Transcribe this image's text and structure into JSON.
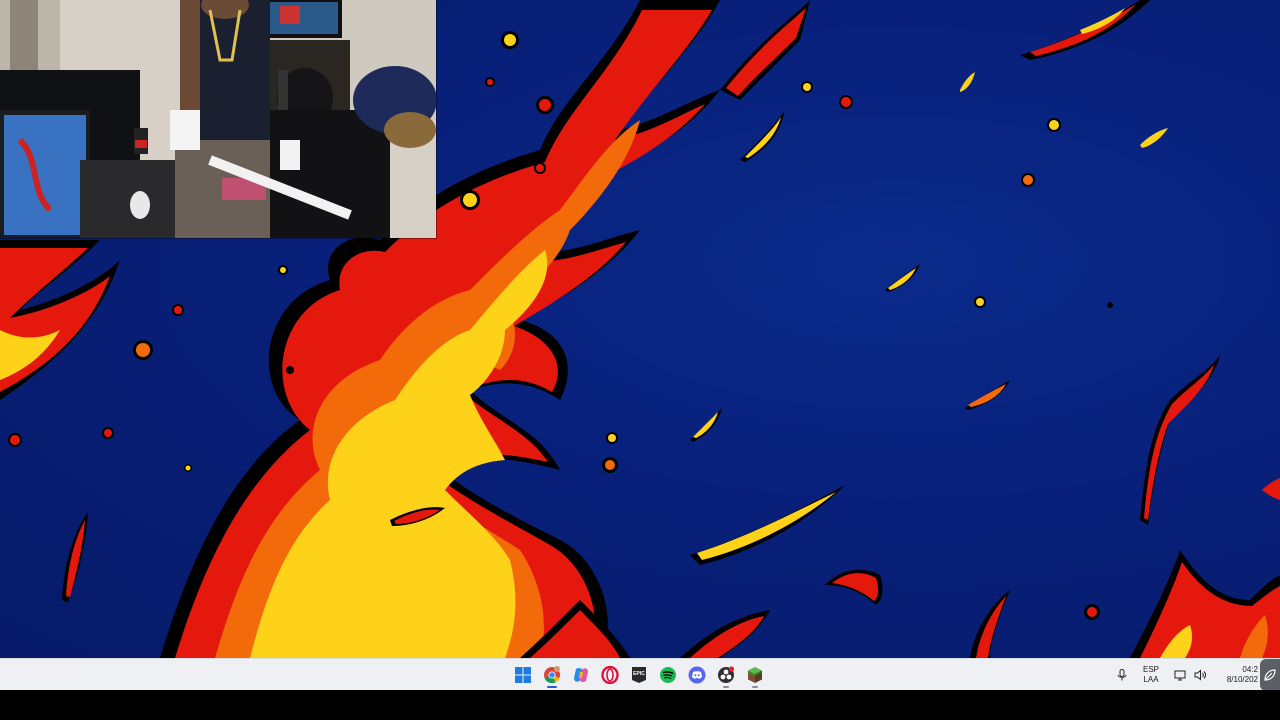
{
  "taskbar": {
    "apps": [
      {
        "id": "start",
        "icon": "windows-start-icon"
      },
      {
        "id": "chrome",
        "icon": "chrome-icon"
      },
      {
        "id": "copilot",
        "icon": "copilot-icon"
      },
      {
        "id": "opera",
        "icon": "opera-icon"
      },
      {
        "id": "epic",
        "icon": "epic-games-icon",
        "label": "EPIC"
      },
      {
        "id": "spotify",
        "icon": "spotify-icon"
      },
      {
        "id": "discord",
        "icon": "discord-icon"
      },
      {
        "id": "obs",
        "icon": "obs-icon"
      },
      {
        "id": "minecraft",
        "icon": "minecraft-icon"
      }
    ],
    "tray": {
      "lang_top": "ESP",
      "lang_bottom": "LAA",
      "time": "04:2",
      "date": "8/10/202"
    }
  },
  "colors": {
    "wallpaper_bg": "#08207a",
    "flame_red": "#e4180c",
    "flame_orange": "#f26a0a",
    "flame_yellow": "#ffd21a",
    "taskbar_bg": "#eef0f3"
  }
}
